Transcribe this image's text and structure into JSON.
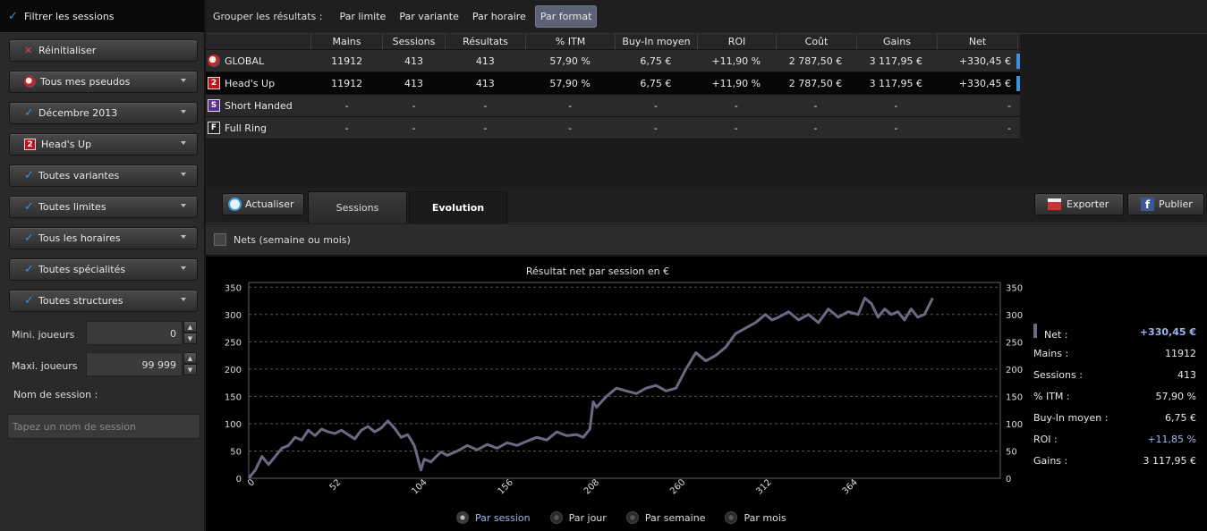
{
  "sidebar": {
    "header": "Filtrer les sessions",
    "reset": "Réinitialiser",
    "filters": [
      {
        "label": "Tous mes pseudos",
        "icon": "pseudo-icon"
      },
      {
        "label": "Décembre 2013",
        "icon": "check-icon"
      },
      {
        "label": "Head's Up",
        "icon": "headsup-badge",
        "badge": "2"
      },
      {
        "label": "Toutes variantes",
        "icon": "check-icon"
      },
      {
        "label": "Toutes limites",
        "icon": "check-icon"
      },
      {
        "label": "Tous les horaires",
        "icon": "check-icon"
      },
      {
        "label": "Toutes spécialités",
        "icon": "check-icon"
      },
      {
        "label": "Toutes structures",
        "icon": "check-icon"
      }
    ],
    "min_players_label": "Mini. joueurs",
    "min_players_value": "0",
    "max_players_label": "Maxi. joueurs",
    "max_players_value": "99 999",
    "session_name_label": "Nom de session :",
    "session_name_placeholder": "Tapez un nom de session"
  },
  "groupbar": {
    "label": "Grouper les résultats :",
    "options": [
      "Par limite",
      "Par variante",
      "Par horaire",
      "Par format"
    ],
    "active": "Par format"
  },
  "table": {
    "columns": [
      "",
      "Mains",
      "Sessions",
      "Résultats",
      "% ITM",
      "Buy-In moyen",
      "ROI",
      "Coût",
      "Gains",
      "Net"
    ],
    "rows": [
      {
        "name": "GLOBAL",
        "icon": "global",
        "badge": "",
        "selected": false,
        "bar": true,
        "cells": [
          "11912",
          "413",
          "413",
          "57,90 %",
          "6,75 €",
          "+11,90 %",
          "2 787,50 €",
          "3 117,95 €",
          "+330,45 €"
        ]
      },
      {
        "name": "Head's Up",
        "icon": "red",
        "badge": "2",
        "selected": true,
        "bar": true,
        "cells": [
          "11912",
          "413",
          "413",
          "57,90 %",
          "6,75 €",
          "+11,90 %",
          "2 787,50 €",
          "3 117,95 €",
          "+330,45 €"
        ]
      },
      {
        "name": "Short Handed",
        "icon": "purple",
        "badge": "S",
        "selected": false,
        "bar": false,
        "cells": [
          "-",
          "-",
          "-",
          "-",
          "-",
          "-",
          "-",
          "-",
          "-"
        ]
      },
      {
        "name": "Full Ring",
        "icon": "dark",
        "badge": "F",
        "selected": false,
        "bar": false,
        "cells": [
          "-",
          "-",
          "-",
          "-",
          "-",
          "-",
          "-",
          "-",
          "-"
        ]
      }
    ]
  },
  "tabs": {
    "refresh": "Actualiser",
    "sessions": "Sessions",
    "evolution": "Evolution",
    "export": "Exporter",
    "publish": "Publier"
  },
  "nets_checkbox": "Nets (semaine ou mois)",
  "stats": [
    {
      "k": "Net :",
      "v": "+330,45 €",
      "style": "blue bold"
    },
    {
      "k": "Mains :",
      "v": "11912",
      "style": ""
    },
    {
      "k": "Sessions :",
      "v": "413",
      "style": ""
    },
    {
      "k": "% ITM :",
      "v": "57,90 %",
      "style": ""
    },
    {
      "k": "Buy-In moyen :",
      "v": "6,75 €",
      "style": ""
    },
    {
      "k": "ROI :",
      "v": "+11,85 %",
      "style": "blue"
    },
    {
      "k": "Gains :",
      "v": "3 117,95 €",
      "style": ""
    }
  ],
  "radios": [
    {
      "label": "Par session",
      "on": true
    },
    {
      "label": "Par jour",
      "on": false
    },
    {
      "label": "Par semaine",
      "on": false
    },
    {
      "label": "Par mois",
      "on": false
    }
  ],
  "chart_data": {
    "type": "line",
    "title": "Résultat net par session en €",
    "xlabel": "",
    "ylabel": "",
    "xlim": [
      0,
      413
    ],
    "ylim": [
      0,
      375
    ],
    "xticks": [
      0,
      52,
      104,
      156,
      208,
      260,
      312,
      364
    ],
    "yticks": [
      0,
      50,
      100,
      150,
      200,
      250,
      300,
      350
    ],
    "grid": true,
    "line_color": "#6a6a84",
    "series": [
      {
        "x": [
          0,
          4,
          8,
          12,
          16,
          20,
          24,
          28,
          32,
          36,
          40,
          44,
          48,
          52,
          56,
          60,
          64,
          68,
          72,
          76,
          80,
          84,
          88,
          92,
          96,
          100,
          104,
          106,
          110,
          116,
          120,
          126,
          132,
          138,
          144,
          150,
          156,
          162,
          168,
          174,
          180,
          186,
          192,
          198,
          202,
          206,
          208,
          210,
          216,
          222,
          228,
          234,
          240,
          246,
          252,
          258,
          264,
          270,
          276,
          282,
          288,
          294,
          300,
          306,
          312,
          316,
          320,
          326,
          332,
          338,
          344,
          350,
          356,
          362,
          368,
          372,
          376,
          380,
          384,
          388,
          392,
          396,
          400,
          404,
          408,
          413
        ],
        "y": [
          0,
          15,
          40,
          25,
          40,
          55,
          60,
          75,
          70,
          88,
          78,
          90,
          85,
          82,
          88,
          80,
          72,
          88,
          95,
          85,
          92,
          105,
          92,
          75,
          80,
          60,
          15,
          35,
          30,
          48,
          42,
          50,
          60,
          52,
          62,
          55,
          65,
          60,
          68,
          75,
          70,
          85,
          78,
          80,
          75,
          90,
          140,
          130,
          150,
          165,
          160,
          155,
          165,
          170,
          160,
          165,
          200,
          230,
          215,
          225,
          240,
          265,
          275,
          285,
          300,
          290,
          295,
          305,
          290,
          300,
          285,
          310,
          295,
          305,
          300,
          330,
          320,
          295,
          310,
          300,
          305,
          290,
          310,
          295,
          300,
          330
        ]
      }
    ]
  }
}
